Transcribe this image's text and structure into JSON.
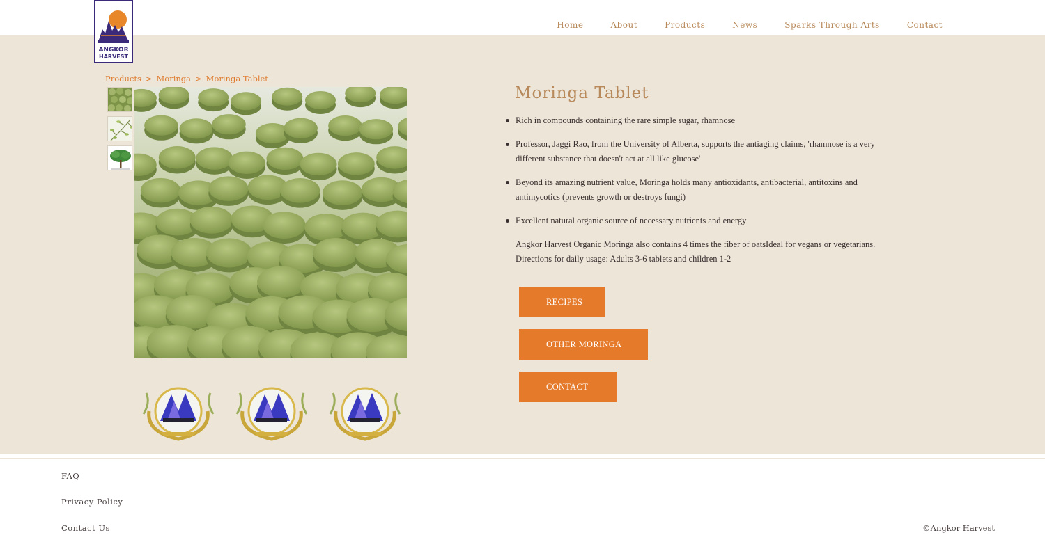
{
  "brand": {
    "logo_line1": "ANGKOR",
    "logo_line2": "HARVEST"
  },
  "nav": [
    {
      "label": "Home"
    },
    {
      "label": "About"
    },
    {
      "label": "Products"
    },
    {
      "label": "News"
    },
    {
      "label": "Sparks Through Arts"
    },
    {
      "label": "Contact"
    }
  ],
  "breadcrumb": {
    "items": [
      "Products",
      "Moringa",
      "Moringa Tablet"
    ],
    "separator": ">"
  },
  "product": {
    "title": "Moringa Tablet",
    "bullets": [
      "Rich in compounds containing the rare simple sugar, rhamnose",
      "Professor, Jaggi Rao, from the University of Alberta, supports the antiaging claims, 'rhamnose is a very different substance that doesn't act at all like glucose'",
      "Beyond its amazing nutrient value, Moringa holds many antioxidants, antibacterial, antitoxins and antimycotics (prevents growth or destroys fungi)",
      "Excellent natural organic source of necessary nutrients and energy"
    ],
    "description_line1": "Angkor Harvest Organic Moringa also contains 4 times the fiber of oatsIdeal for vegans or vegetarians.",
    "description_line2": "Directions for daily usage: Adults 3-6 tablets and children 1-2"
  },
  "buttons": {
    "recipes": "RECIPES",
    "other": "OTHER MORINGA",
    "contact": "CONTACT"
  },
  "footer": {
    "faq": "FAQ",
    "privacy": "Privacy Policy",
    "contact": "Contact Us",
    "copyright": "©Angkor Harvest"
  },
  "colors": {
    "accent": "#e57a2a",
    "nav_text": "#b8895a",
    "band_bg": "#ece5d8",
    "logo_border": "#3b2a7a"
  }
}
